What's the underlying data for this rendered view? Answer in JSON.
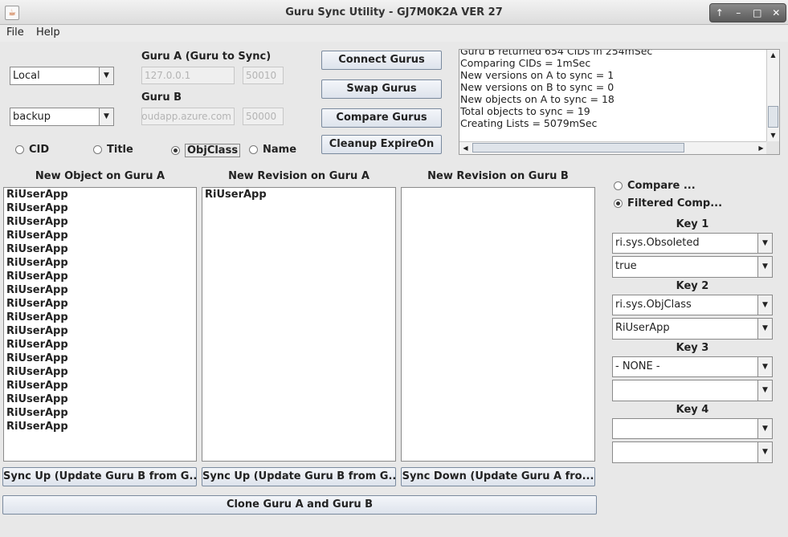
{
  "window": {
    "title": "Guru Sync Utility - GJ7M0K2A VER 27",
    "controls": [
      "↑",
      "–",
      "□",
      "✕"
    ]
  },
  "menu": {
    "items": [
      "File",
      "Help"
    ]
  },
  "connection": {
    "guru_a_label": "Guru A (Guru to Sync)",
    "guru_b_label": "Guru B",
    "guru_a_mode": "Local",
    "guru_b_mode": "backup",
    "guru_a_host": "127.0.0.1",
    "guru_a_port": "50010",
    "guru_b_host": "oudapp.azure.com",
    "guru_b_port": "50000"
  },
  "radios": [
    {
      "label": "CID",
      "selected": false
    },
    {
      "label": "Title",
      "selected": false
    },
    {
      "label": "ObjClass",
      "selected": true
    },
    {
      "label": "Name",
      "selected": false
    }
  ],
  "buttons": {
    "connect": "Connect Gurus",
    "swap": "Swap Gurus",
    "compare": "Compare Gurus",
    "cleanup": "Cleanup ExpireOn",
    "sync_up_1": "Sync Up (Update Guru B from G...",
    "sync_up_2": "Sync Up (Update Guru B from G...",
    "sync_down": "Sync Down (Update Guru A fro...",
    "clone": "Clone Guru A and Guru B"
  },
  "log": [
    "Guru B returned 654 CIDs in 254mSec",
    "Comparing CIDs = 1mSec",
    "New versions on A to sync = 1",
    "New versions on B to sync = 0",
    "New objects on A to sync = 18",
    "Total objects to sync = 19",
    "Creating Lists = 5079mSec"
  ],
  "lists": {
    "new_object_a": {
      "title": "New Object on Guru A",
      "items": [
        "RiUserApp",
        "RiUserApp",
        "RiUserApp",
        "RiUserApp",
        "RiUserApp",
        "RiUserApp",
        "RiUserApp",
        "RiUserApp",
        "RiUserApp",
        "RiUserApp",
        "RiUserApp",
        "RiUserApp",
        "RiUserApp",
        "RiUserApp",
        "RiUserApp",
        "RiUserApp",
        "RiUserApp",
        "RiUserApp"
      ]
    },
    "new_revision_a": {
      "title": "New Revision on Guru A",
      "items": [
        "RiUserApp"
      ]
    },
    "new_revision_b": {
      "title": "New Revision on Guru B",
      "items": []
    }
  },
  "filter": {
    "compare_label": "Compare ...",
    "filtered_label": "Filtered Comp...",
    "compare_selected": false,
    "filtered_selected": true,
    "keys": [
      {
        "label": "Key 1",
        "field": "ri.sys.Obsoleted",
        "value": "true"
      },
      {
        "label": "Key 2",
        "field": "ri.sys.ObjClass",
        "value": "RiUserApp"
      },
      {
        "label": "Key 3",
        "field": "- NONE -",
        "value": ""
      },
      {
        "label": "Key 4",
        "field": "",
        "value": ""
      }
    ]
  }
}
